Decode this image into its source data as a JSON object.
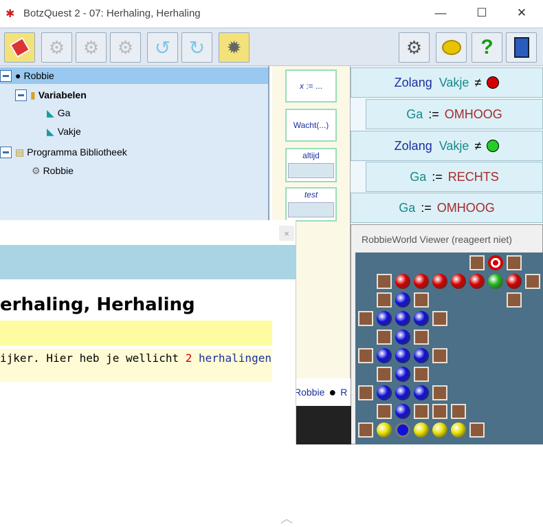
{
  "window": {
    "title": "BotzQuest 2 - 07: Herhaling, Herhaling"
  },
  "tree": {
    "items": [
      {
        "label": "Robbie",
        "bold": false
      },
      {
        "label": "Variabelen",
        "bold": true
      },
      {
        "label": "Ga",
        "bold": false
      },
      {
        "label": "Vakje",
        "bold": false
      },
      {
        "label": "Programma Bibliotheek",
        "bold": false
      },
      {
        "label": "Robbie",
        "bold": false
      }
    ]
  },
  "statements": {
    "assign": {
      "var": "x",
      "rest": ":= ..."
    },
    "wait": "Wacht(...)",
    "always": "altijd",
    "test": "test"
  },
  "code": {
    "rows": [
      {
        "kw": "Zolang",
        "var": "Vakje",
        "op": "≠",
        "val": "red-dot"
      },
      {
        "kw": "Ga",
        "op": ":=",
        "val": "OMHOOG"
      },
      {
        "kw": "Zolang",
        "var": "Vakje",
        "op": "≠",
        "val": "green-dot"
      },
      {
        "kw": "Ga",
        "op": ":=",
        "val": "RECHTS"
      },
      {
        "kw": "Ga",
        "op": ":=",
        "val": "OMHOOG"
      }
    ]
  },
  "viewer": {
    "title": "RobbieWorld Viewer (reageert niet)"
  },
  "status": {
    "robot_name": "Robbie",
    "trailing": "R"
  },
  "help": {
    "title": "erhaling, Herhaling",
    "text_before": "ijker. Hier heb je wellicht ",
    "number": "2",
    "text_link": "herhalingen",
    "close": "×"
  },
  "colors": {
    "red": "#d40000",
    "green": "#22b522",
    "blue": "#1010d8",
    "yellow": "#e8e000"
  }
}
